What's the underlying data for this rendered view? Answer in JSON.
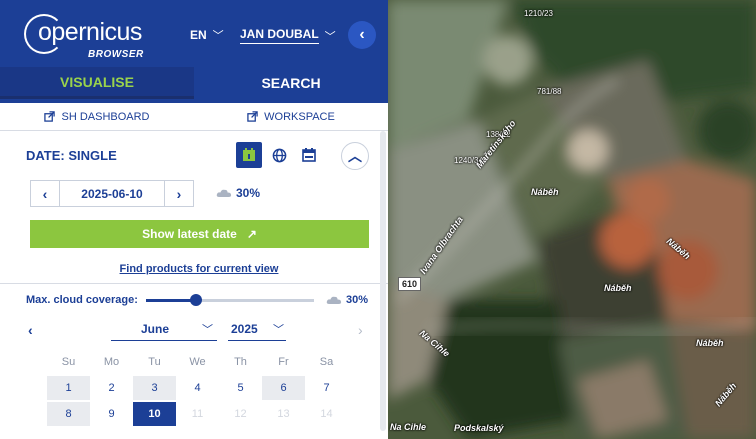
{
  "header": {
    "logo_text": "opernicus",
    "logo_sub": "BROWSER",
    "language": "EN",
    "user": "JAN DOUBAL",
    "collapse_icon": "chevron-left-icon"
  },
  "tabs": [
    {
      "label": "VISUALISE",
      "active": true
    },
    {
      "label": "SEARCH",
      "active": false
    }
  ],
  "links": {
    "dashboard": "SH DASHBOARD",
    "workspace": "WORKSPACE"
  },
  "date_section": {
    "title": "DATE: SINGLE",
    "date_value": "2025-06-10",
    "cloud_percent": "30%",
    "show_latest_label": "Show latest date",
    "find_products_label": "Find products for current view"
  },
  "cloud_filter": {
    "label": "Max. cloud coverage:",
    "value_label": "30%",
    "value": 0.3
  },
  "calendar": {
    "month": "June",
    "year": "2025",
    "weekdays": [
      "Su",
      "Mo",
      "Tu",
      "We",
      "Th",
      "Fr",
      "Sa"
    ],
    "days": [
      {
        "n": "1",
        "state": "has-data"
      },
      {
        "n": "2",
        "state": ""
      },
      {
        "n": "3",
        "state": "has-data"
      },
      {
        "n": "4",
        "state": ""
      },
      {
        "n": "5",
        "state": ""
      },
      {
        "n": "6",
        "state": "has-data"
      },
      {
        "n": "7",
        "state": ""
      },
      {
        "n": "8",
        "state": "has-data"
      },
      {
        "n": "9",
        "state": ""
      },
      {
        "n": "10",
        "state": "selected"
      },
      {
        "n": "11",
        "state": "future"
      },
      {
        "n": "12",
        "state": "future"
      },
      {
        "n": "13",
        "state": "future"
      },
      {
        "n": "14",
        "state": "future"
      }
    ]
  },
  "colors": {
    "brand_blue": "#1c3f96",
    "accent_green": "#8cc63f"
  },
  "map": {
    "labels": [
      {
        "text": "1210/23",
        "kind": "number"
      },
      {
        "text": "781/88",
        "kind": "number"
      },
      {
        "text": "138/12",
        "kind": "number"
      },
      {
        "text": "1240/34",
        "kind": "number"
      },
      {
        "text": "Mařetínského",
        "kind": "street"
      },
      {
        "text": "Náběh",
        "kind": "street"
      },
      {
        "text": "Ivana Olbrachta",
        "kind": "street"
      },
      {
        "text": "Náběh",
        "kind": "street"
      },
      {
        "text": "Náběh",
        "kind": "street"
      },
      {
        "text": "Na Cihle",
        "kind": "street"
      },
      {
        "text": "Náběh",
        "kind": "street"
      },
      {
        "text": "Náběh",
        "kind": "street"
      },
      {
        "text": "Na Cihle",
        "kind": "street"
      },
      {
        "text": "Podskalský",
        "kind": "street"
      }
    ],
    "road_number": "610"
  }
}
